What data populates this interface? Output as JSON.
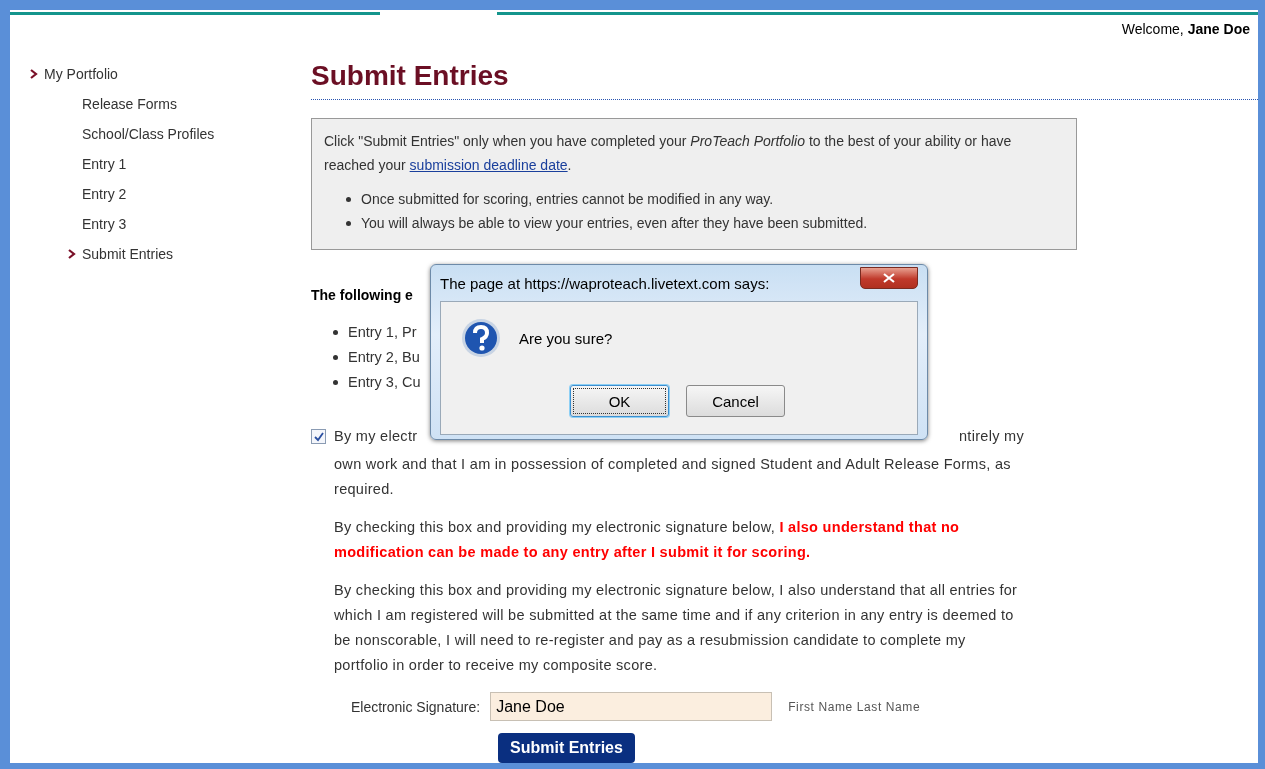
{
  "header": {
    "welcome_label": "Welcome,",
    "user_name": "Jane Doe"
  },
  "sidebar": {
    "items": [
      {
        "label": "My Portfolio",
        "expanded": true,
        "children": [
          {
            "label": "Release Forms",
            "selected": false
          },
          {
            "label": "School/Class Profiles",
            "selected": false
          },
          {
            "label": "Entry 1",
            "selected": false
          },
          {
            "label": "Entry 2",
            "selected": false
          },
          {
            "label": "Entry 3",
            "selected": false
          },
          {
            "label": "Submit Entries",
            "selected": true
          }
        ]
      }
    ]
  },
  "page_title": "Submit Entries",
  "notice": {
    "text": "Click \"Submit Entries\" only when you have completed your *ProTeach Portfolio* to the best of your ability or have reached your ",
    "link": "submission deadline date",
    "text_end": ".",
    "bullets": [
      "Once submitted for scoring, entries cannot be modified in any way.",
      "You will always be able to view your entries, even after they have been submitted."
    ]
  },
  "entries_heading": "The following e",
  "entries": [
    "Entry 1, Pr",
    "Entry 2, Bu",
    "Entry 3, Cu"
  ],
  "agreement": {
    "checked": true,
    "line_start": "By my electr",
    "line_end": "ntirely my",
    "rest": "own work and that I am in possession of completed and signed Student and Adult Release Forms, as required."
  },
  "paragraphs": [
    "By checking this box and providing my electronic signature below, **I also understand that no modification can be made to any entry after I submit it for scoring.**",
    "By checking this box and providing my electronic signature below, I also understand that all entries for which I am registered will be submitted at the same time and if any criterion in any entry is deemed to be nonscorable, I will need to re-register and pay as a resubmission candidate to complete my portfolio in order to receive my composite score."
  ],
  "signature": {
    "label": "Electronic Signature:",
    "value": "Jane Doe",
    "hint": "First Name Last Name"
  },
  "submit_button": "Submit Entries",
  "dialog": {
    "title": "The page at https://waproteach.livetext.com says:",
    "message": "Are you sure?",
    "buttons": [
      {
        "label": "OK",
        "focused": true
      },
      {
        "label": "Cancel",
        "focused": false
      }
    ]
  }
}
